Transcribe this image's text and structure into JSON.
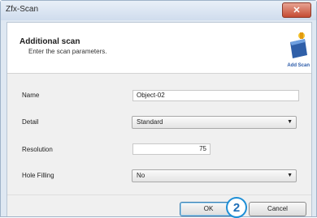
{
  "window": {
    "title": "Zfx-Scan",
    "close_label": "✕"
  },
  "header": {
    "title": "Additional scan",
    "subtitle": "Enter the scan parameters.",
    "logo_caption": "Add Scan"
  },
  "form": {
    "name": {
      "label": "Name",
      "value": "Object-02"
    },
    "detail": {
      "label": "Detail",
      "selected": "Standard"
    },
    "resolution": {
      "label": "Resolution",
      "value": "75"
    },
    "hole_filling": {
      "label": "Hole Filling",
      "selected": "No"
    }
  },
  "buttons": {
    "ok": "OK",
    "cancel": "Cancel"
  },
  "callout": "2",
  "colors": {
    "accent": "#1f8fd6",
    "titlebar": "#cfdced",
    "close": "#c44b33"
  }
}
